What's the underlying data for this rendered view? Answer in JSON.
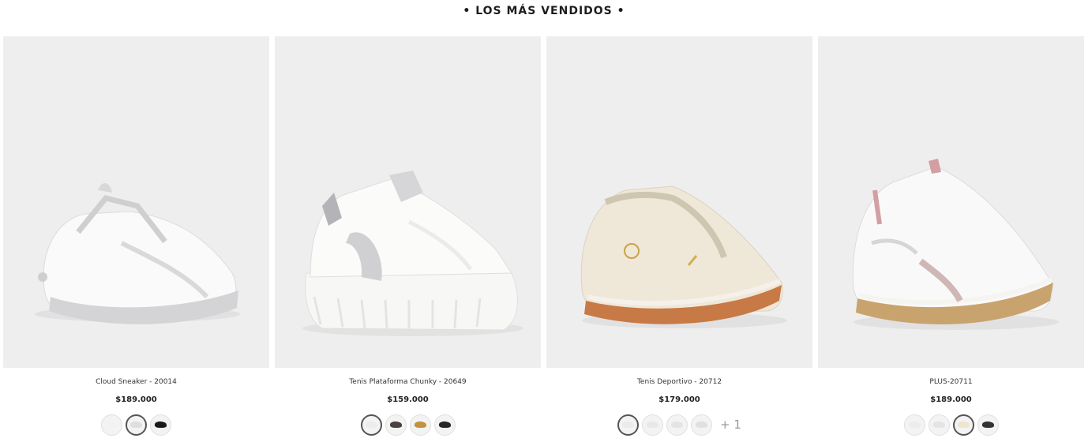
{
  "section": {
    "title": "• LOS MÁS VENDIDOS •"
  },
  "products": [
    {
      "name": "Cloud Sneaker - 20014",
      "price": "$189.000",
      "swatches": [
        {
          "color": "#f2f2f2",
          "selected": false
        },
        {
          "color": "#dedede",
          "selected": true
        },
        {
          "color": "#1a1a1a",
          "selected": false
        }
      ],
      "more": ""
    },
    {
      "name": "Tenis Plataforma Chunky - 20649",
      "price": "$159.000",
      "swatches": [
        {
          "color": "#ececec",
          "selected": true
        },
        {
          "color": "#4a4240",
          "selected": false
        },
        {
          "color": "#c4913e",
          "selected": false
        },
        {
          "color": "#262626",
          "selected": false
        }
      ],
      "more": ""
    },
    {
      "name": "Tenis Deportivo - 20712",
      "price": "$179.000",
      "swatches": [
        {
          "color": "#ebebeb",
          "selected": true
        },
        {
          "color": "#e8e8e8",
          "selected": false
        },
        {
          "color": "#e4e4e4",
          "selected": false
        },
        {
          "color": "#e0e0e0",
          "selected": false
        }
      ],
      "more": "+ 1"
    },
    {
      "name": "PLUS-20711",
      "price": "$189.000",
      "swatches": [
        {
          "color": "#ececec",
          "selected": false
        },
        {
          "color": "#e4e4e4",
          "selected": false
        },
        {
          "color": "#eee5cc",
          "selected": true
        },
        {
          "color": "#333333",
          "selected": false
        }
      ],
      "more": ""
    }
  ]
}
